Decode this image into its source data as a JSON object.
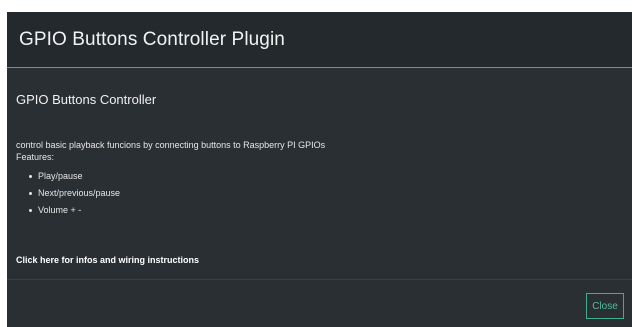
{
  "modal": {
    "title": "GPIO Buttons Controller Plugin",
    "accent_color": "#3fae8c"
  },
  "body": {
    "section_title": "GPIO Buttons Controller",
    "description": "control basic playback funcions by connecting buttons to Raspberry PI GPIOs",
    "features_label": "Features:",
    "features": [
      "Play/pause",
      "Next/previous/pause",
      "Volume + -"
    ],
    "info_link": "Click here for infos and wiring instructions"
  },
  "footer": {
    "close_label": "Close"
  }
}
